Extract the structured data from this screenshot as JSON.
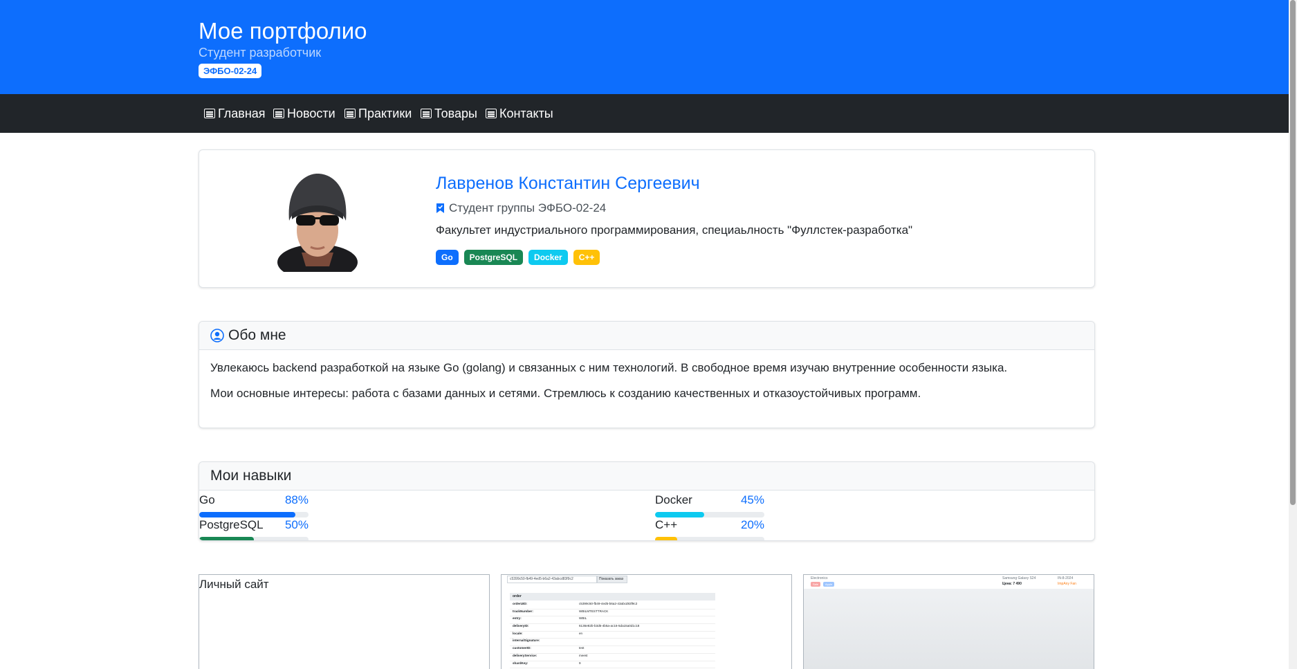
{
  "header": {
    "title": "Мое портфолио",
    "subtitle": "Студент разработчик",
    "badge": "ЭФБО-02-24"
  },
  "nav": {
    "items": [
      {
        "label": "Главная",
        "icon": "news-icon"
      },
      {
        "label": "Новости",
        "icon": "news-icon"
      },
      {
        "label": "Практики",
        "icon": "news-icon"
      },
      {
        "label": "Товары",
        "icon": "news-icon"
      },
      {
        "label": "Контакты",
        "icon": "news-icon"
      }
    ]
  },
  "profile": {
    "name": "Лавренов Константин Сергеевич",
    "group": "Студент группы ЭФБО-02-24",
    "faculty": "Факультет индустриального программирования, специаьлность \"Фуллстек-разработка\"",
    "tags": [
      {
        "label": "Go",
        "color": "#0d6efd"
      },
      {
        "label": "PostgreSQL",
        "color": "#198754"
      },
      {
        "label": "Docker",
        "color": "#0dcaf0"
      },
      {
        "label": "C++",
        "color": "#ffc107"
      }
    ]
  },
  "about": {
    "title": "Обо мне",
    "p1": "Увлекаюсь backend разработкой на языке Go (golang) и связанных с ним технологий. В свободное время изучаю внутренние особенности языка.",
    "p2": "Мои основные интересы: работа с базами данных и сетями. Стремлюсь к созданию качественных и отказоустойчивых программ."
  },
  "skills": {
    "title": "Мои навыки",
    "items": [
      {
        "name": "Go",
        "percent_label": "88%",
        "value": 0.88,
        "color": "#0d6efd"
      },
      {
        "name": "Docker",
        "percent_label": "45%",
        "value": 0.45,
        "color": "#0dcaf0"
      },
      {
        "name": "PostgreSQL",
        "percent_label": "50%",
        "value": 0.5,
        "color": "#198754"
      },
      {
        "name": "C++",
        "percent_label": "20%",
        "value": 0.2,
        "color": "#ffc107"
      }
    ]
  },
  "projects": {
    "first_title": "Личный сайт",
    "order_id": "c5399c50-fb49-4ed5-b6a2-43abcd83f9c2",
    "show_order_button": "Показать заказ",
    "table_header": "order",
    "fields": [
      {
        "key": "orderUID:",
        "value": "c5399c50-fb49-4ed5-b6a2-43abcd83f9c2"
      },
      {
        "key": "trackNumber:",
        "value": "WBILMTESTTRACK"
      },
      {
        "key": "entry:",
        "value": "WBIL"
      },
      {
        "key": "deliveryID:",
        "value": "6136e82b-b3d6-4b5a-ac16-5da15a0d1c18"
      },
      {
        "key": "locale:",
        "value": "en"
      },
      {
        "key": "internalSignature:",
        "value": ""
      },
      {
        "key": "customerID:",
        "value": "test"
      },
      {
        "key": "deliveryService:",
        "value": "meest"
      },
      {
        "key": "shardKey:",
        "value": "9"
      }
    ],
    "third_left": "Electronics",
    "third_badge_1": "Sale",
    "third_badge_2": "Apple",
    "third_right_1": "Samsung Galaxy S24",
    "third_right_2": "Цена: 7 490",
    "third_right_3": "IN-8-2024",
    "third_right_4": "ImpAny Fan"
  }
}
